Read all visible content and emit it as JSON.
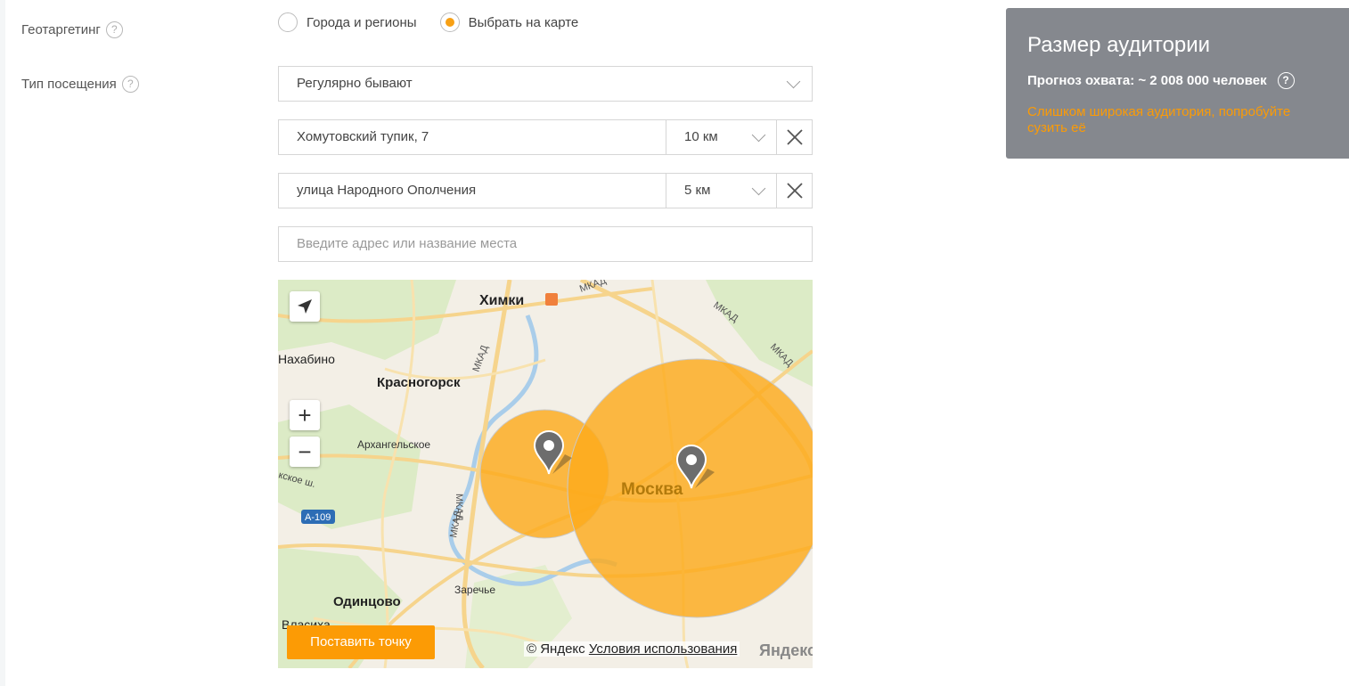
{
  "geo": {
    "label": "Геотаргетинг",
    "options": [
      {
        "label": "Города и регионы",
        "selected": false
      },
      {
        "label": "Выбрать на карте",
        "selected": true
      }
    ]
  },
  "visit": {
    "label": "Тип посещения",
    "selected": "Регулярно бывают"
  },
  "locations": [
    {
      "address": "Хомутовский тупик, 7",
      "radius": "10 км"
    },
    {
      "address": "улица Народного Ополчения",
      "radius": "5 км"
    }
  ],
  "address_input": {
    "placeholder": "Введите адрес или название места",
    "value": ""
  },
  "map": {
    "labels": {
      "khimki": "Химки",
      "nakhabino": "Нахабино",
      "krasnogorsk": "Красногорск",
      "arkhangelskoe": "Архангельское",
      "moskva": "Москва",
      "odintsovo": "Одинцово",
      "zarechye": "Заречье",
      "vlasikha": "Власиха",
      "mkad": "МКАД",
      "a109": "А-109",
      "rublevo": "кское ш."
    },
    "place_button": "Поставить точку",
    "copyright": "© Яндекс",
    "terms": "Условия использования",
    "logo": "Яндекс",
    "zoom_in": "+",
    "zoom_out": "−",
    "colors": {
      "circle": "#fcab1c",
      "pin": "#6d6d6d"
    }
  },
  "audience": {
    "title": "Размер аудитории",
    "forecast": "Прогноз охвата: ~ 2 008 000 человек",
    "warning": "Слишком широкая аудитория, попробуйте сузить её"
  },
  "colors": {
    "accent": "#fc9b05",
    "panel_bg": "#85888e"
  }
}
